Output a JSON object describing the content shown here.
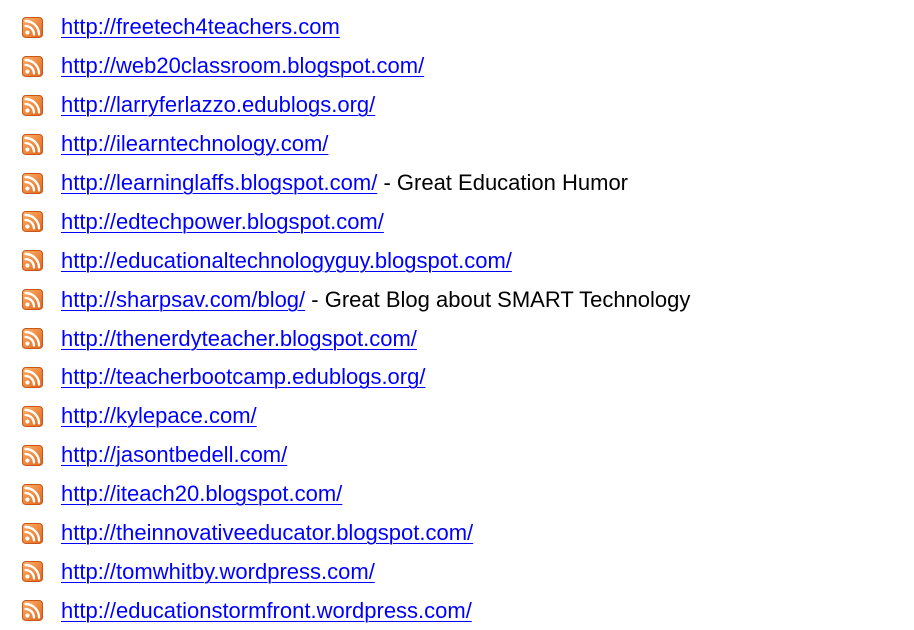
{
  "colors": {
    "link": "#0000ff",
    "text": "#000000",
    "rss_icon": "#f47d20"
  },
  "icon": "rss-feed-icon",
  "feeds": [
    {
      "url": "http://freetech4teachers.com",
      "note": ""
    },
    {
      "url": "http://web20classroom.blogspot.com/",
      "note": ""
    },
    {
      "url": "http://larryferlazzo.edublogs.org/",
      "note": ""
    },
    {
      "url": "http://ilearntechnology.com/",
      "note": ""
    },
    {
      "url": "http://learninglaffs.blogspot.com/",
      "note": " - Great Education Humor"
    },
    {
      "url": "http://edtechpower.blogspot.com/",
      "note": ""
    },
    {
      "url": "http://educationaltechnologyguy.blogspot.com/",
      "note": ""
    },
    {
      "url": "http://sharpsav.com/blog/",
      "note": " - Great Blog about SMART Technology"
    },
    {
      "url": "http://thenerdyteacher.blogspot.com/",
      "note": ""
    },
    {
      "url": "http://teacherbootcamp.edublogs.org/",
      "note": ""
    },
    {
      "url": "http://kylepace.com/",
      "note": ""
    },
    {
      "url": "http://jasontbedell.com/",
      "note": ""
    },
    {
      "url": "http://iteach20.blogspot.com/",
      "note": ""
    },
    {
      "url": "http://theinnovativeeducator.blogspot.com/",
      "note": ""
    },
    {
      "url": "http://tomwhitby.wordpress.com/",
      "note": ""
    },
    {
      "url": "http://educationstormfront.wordpress.com/",
      "note": ""
    }
  ]
}
